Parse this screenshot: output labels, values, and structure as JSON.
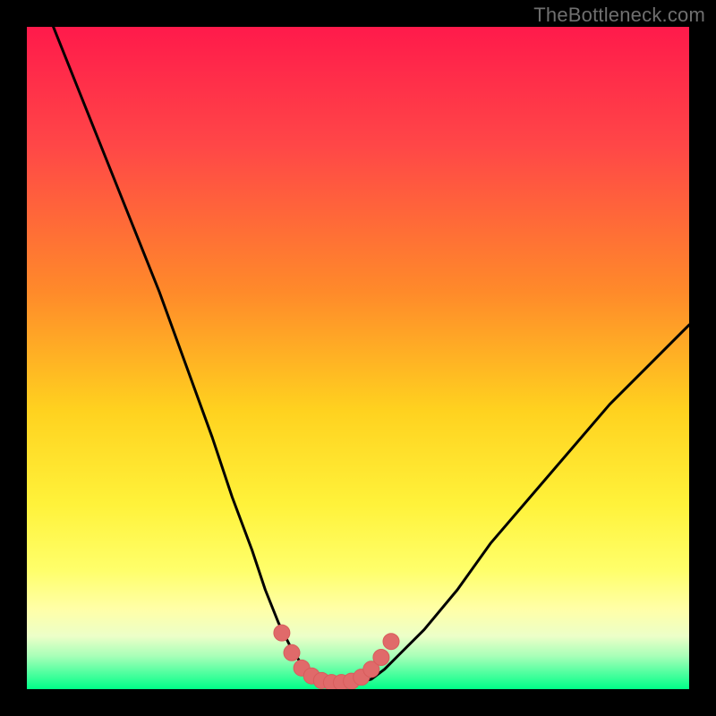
{
  "watermark": {
    "text": "TheBottleneck.com"
  },
  "colors": {
    "gradient_stops": [
      {
        "pct": 0,
        "color": "#ff1a4b"
      },
      {
        "pct": 18,
        "color": "#ff4747"
      },
      {
        "pct": 40,
        "color": "#ff8a2a"
      },
      {
        "pct": 58,
        "color": "#ffd21f"
      },
      {
        "pct": 72,
        "color": "#fff23a"
      },
      {
        "pct": 82,
        "color": "#ffff6a"
      },
      {
        "pct": 88,
        "color": "#ffffa8"
      },
      {
        "pct": 92,
        "color": "#ecffc8"
      },
      {
        "pct": 95,
        "color": "#a8ffb8"
      },
      {
        "pct": 97.5,
        "color": "#52ffa0"
      },
      {
        "pct": 100,
        "color": "#00ff88"
      }
    ],
    "curve_stroke": "#000000",
    "marker_fill": "#e06a6a",
    "marker_stroke": "#d85c5c"
  },
  "chart_data": {
    "type": "line",
    "title": "",
    "xlabel": "",
    "ylabel": "",
    "xlim": [
      0,
      100
    ],
    "ylim": [
      0,
      100
    ],
    "note": "XY values are read in percent of the plot area. Y=100 is top, Y=0 is bottom. Curve descends steeply from top-left, reaches a near-zero minimum around x≈42–52, then rises more gently toward the right edge reaching roughly y≈55.",
    "series": [
      {
        "name": "bottleneck-curve",
        "x": [
          4,
          8,
          12,
          16,
          20,
          24,
          28,
          31,
          34,
          36,
          38,
          40,
          42,
          45,
          48,
          50,
          52,
          54,
          56,
          60,
          65,
          70,
          76,
          82,
          88,
          94,
          100
        ],
        "y": [
          100,
          90,
          80,
          70,
          60,
          49,
          38,
          29,
          21,
          15,
          10,
          6,
          3,
          1.5,
          1,
          1,
          1.5,
          3,
          5,
          9,
          15,
          22,
          29,
          36,
          43,
          49,
          55
        ]
      }
    ],
    "markers": {
      "name": "highlighted-minimum",
      "x": [
        38.5,
        40,
        41.5,
        43,
        44.5,
        46,
        47.5,
        49,
        50.5,
        52,
        53.5,
        55
      ],
      "y": [
        8.5,
        5.5,
        3.2,
        2.0,
        1.3,
        1.0,
        1.0,
        1.2,
        1.8,
        3.0,
        4.8,
        7.2
      ]
    }
  }
}
